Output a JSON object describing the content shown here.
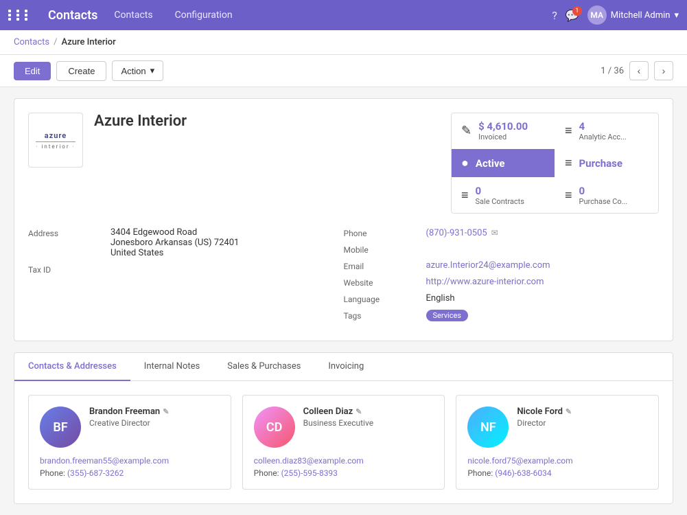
{
  "app": {
    "name": "Contacts",
    "grid_icon": "grid-icon"
  },
  "topnav": {
    "links": [
      "Contacts",
      "Configuration"
    ],
    "help_icon": "?",
    "chat_badge": "1",
    "user_name": "Mitchell Admin",
    "user_initials": "MA"
  },
  "breadcrumb": {
    "parent": "Contacts",
    "separator": "/",
    "current": "Azure Interior"
  },
  "toolbar": {
    "edit_label": "Edit",
    "create_label": "Create",
    "action_label": "Action",
    "nav_count": "1 / 36"
  },
  "company": {
    "name": "Azure Interior",
    "logo_line1": "azure",
    "logo_line2": "· interior ·"
  },
  "stats": [
    {
      "value": "$ 4,610.00",
      "label": "Invoiced",
      "icon": "✎"
    },
    {
      "value": "4",
      "label": "Analytic Acc...",
      "icon": "≡"
    },
    {
      "value": "Active",
      "label": "",
      "icon": "●",
      "active": true
    },
    {
      "value": "Purchase",
      "label": "",
      "icon": "≡"
    },
    {
      "value": "0",
      "label": "Sale Contracts",
      "icon": "≡"
    },
    {
      "value": "0",
      "label": "Purchase Co...",
      "icon": "≡"
    }
  ],
  "fields": {
    "address_label": "Address",
    "address_line1": "3404 Edgewood Road",
    "address_line2": "Jonesboro  Arkansas (US)  72401",
    "address_line3": "United States",
    "taxid_label": "Tax ID",
    "taxid_value": "",
    "phone_label": "Phone",
    "phone_value": "(870)-931-0505",
    "mobile_label": "Mobile",
    "email_label": "Email",
    "email_value": "azure.Interior24@example.com",
    "website_label": "Website",
    "website_value": "http://www.azure-interior.com",
    "language_label": "Language",
    "language_value": "English",
    "tags_label": "Tags",
    "tags_value": "Services"
  },
  "tabs": [
    {
      "label": "Contacts & Addresses",
      "active": true
    },
    {
      "label": "Internal Notes",
      "active": false
    },
    {
      "label": "Sales & Purchases",
      "active": false
    },
    {
      "label": "Invoicing",
      "active": false
    }
  ],
  "contacts": [
    {
      "name": "Brandon Freeman",
      "title": "Creative Director",
      "email": "brandon.freeman55@example.com",
      "phone": "(355)-687-3262",
      "initials": "BF",
      "color": "#5b6abf"
    },
    {
      "name": "Colleen Diaz",
      "title": "Business Executive",
      "email": "colleen.diaz83@example.com",
      "phone": "(255)-595-8393",
      "initials": "CD",
      "color": "#c05ba0"
    },
    {
      "name": "Nicole Ford",
      "title": "Director",
      "email": "nicole.ford75@example.com",
      "phone": "(946)-638-6034",
      "initials": "NF",
      "color": "#5bafc0"
    }
  ]
}
